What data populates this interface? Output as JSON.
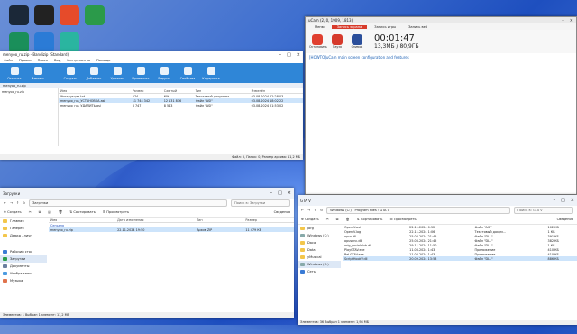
{
  "desktop": {
    "icons": [
      {
        "name": "steam",
        "color": "#1b2838"
      },
      {
        "name": "gta4",
        "color": "#222"
      },
      {
        "name": "fire",
        "color": "#e64b2a"
      },
      {
        "name": "vice-city",
        "color": "#2b9a4a"
      },
      {
        "name": "karaoke",
        "color": "#1a8f5a"
      },
      {
        "name": "photo",
        "color": "#2b7bd6"
      },
      {
        "name": "gamepad",
        "color": "#2ab5a0"
      }
    ]
  },
  "bandizip": {
    "title": "menyoo_ru.zip - Bandizip (Standard)",
    "menu": [
      "Файл",
      "Правка",
      "Поиск",
      "Вид",
      "Инструменты",
      "Помощь"
    ],
    "tools": [
      "Открыть",
      "Извлечь",
      "Создать",
      "Добавить",
      "Удалить",
      "Проверить",
      "Вирусы",
      "Свойства",
      "Кодировка"
    ],
    "path": "menyoo_ru.zip",
    "tree_item": "menyoo_ru.zip",
    "columns": [
      "Имя",
      "Размер",
      "Сжатый",
      "Тип",
      "Изменён"
    ],
    "rows": [
      {
        "name": "Инструкция.txt",
        "size": "274",
        "packed": "606",
        "type": "Текстовый документ",
        "date": "03.08.2024 22:28:03"
      },
      {
        "name": "menyoo_rus_УСТАНОВКА.asi",
        "size": "11 744 342",
        "packed": "12 131 816",
        "type": "Файл \"ASI\"",
        "date": "03.08.2024 18:02:22"
      },
      {
        "name": "menyoo_rus_УДАЛИТЬ.asi",
        "size": "8 747",
        "packed": "8 543",
        "type": "Файл \"ASI\"",
        "date": "03.08.2024 21:53:02"
      }
    ],
    "status": "Файл: 3, Папок: 0, Размер архива: 11,2 МБ"
  },
  "ucam": {
    "title": "uCam (2, 0, 1909, 1813)",
    "tabs": [
      "Меню",
      "Запись экрана",
      "Запись игры",
      "Запись веб"
    ],
    "buttons": [
      "Остановить",
      "Пауза",
      "Снимок"
    ],
    "timer": "00:01:47",
    "size": "13,3МБ / 80,9ГБ",
    "link": "[HOWTO]uCam main screen configuration and features"
  },
  "downloads": {
    "title": "Загрузки",
    "toolbar": [
      "Создать",
      "Сортировать",
      "Просмотреть"
    ],
    "details": "Сведения",
    "address": "Загрузки",
    "search": "Поиск в: Загрузки",
    "nav": [
      "Главная",
      "Галерея",
      "Давид - личн",
      "Рабочий стол",
      "Загрузки",
      "Документы",
      "Изображени",
      "Музыка"
    ],
    "columns": [
      "Имя",
      "Дата изменения",
      "Тип",
      "Размер"
    ],
    "group": "Сегодня",
    "file": {
      "name": "menyoo_ru.zip",
      "date": "22.11.2024 19:50",
      "type": "Архив ZIP",
      "size": "11 479 КБ"
    },
    "status": "Элементов: 1   Выбран 1 элемент: 11,2 МБ"
  },
  "gta": {
    "title": "GTA V",
    "toolbar": [
      "Создать",
      "Сортировать",
      "Просмотреть"
    ],
    "details": "Сведения",
    "address": [
      "Windows (C:)",
      "Program Files",
      "GTA V"
    ],
    "search": "Поиск в: GTA V",
    "nav": [
      "Jorg",
      "Windows (C:)",
      "Dacal",
      "Data",
      "yMusical",
      "Windows (C:)",
      "Сеть"
    ],
    "rows": [
      {
        "name": "OpenIV.asi",
        "date": "22.11.2024 0:52",
        "type": "Файл \"ASI\"",
        "size": "102 КБ"
      },
      {
        "name": "OpenIV.log",
        "date": "22.11.2024 1:06",
        "type": "Текстовый докум...",
        "size": "1 КБ"
      },
      {
        "name": "opus.dll",
        "date": "25.06.2024 21:45",
        "type": "Файл \"DLL\"",
        "size": "391 КБ"
      },
      {
        "name": "opusenc.dll",
        "date": "25.06.2024 21:45",
        "type": "Файл \"DLL\"",
        "size": "382 КБ"
      },
      {
        "name": "orig_socialclub.dll",
        "date": "29.11.2024 11:50",
        "type": "Файл \"DLL\"",
        "size": "1 КБ"
      },
      {
        "name": "PlayGTAV.exe",
        "date": "11.06.2024 1:43",
        "type": "Приложение",
        "size": "410 КБ"
      },
      {
        "name": "ReLGTAV.exe",
        "date": "11.06.2024 1:43",
        "type": "Приложение",
        "size": "410 КБ"
      },
      {
        "name": "ScriptHookV.dll",
        "date": "20.09.2024 13:53",
        "type": "Файл \"DLL\"",
        "size": "886 КБ"
      }
    ],
    "status": "Элементов: 36   Выбран 1 элемент: 1,98 МБ"
  }
}
